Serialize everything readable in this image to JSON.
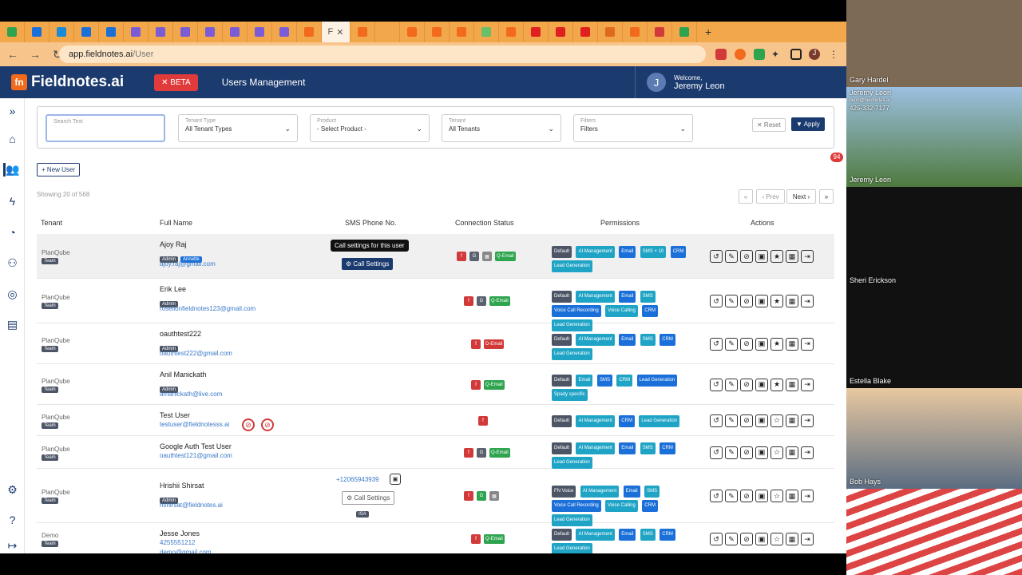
{
  "browser": {
    "active_tab_label": "F",
    "url_host": "app.fieldnotes.ai",
    "url_path": "/User",
    "tab_count": 28
  },
  "app": {
    "logo_text": "Fieldnotes.ai",
    "logo_mark": "fn",
    "beta_label": "✕ BETA",
    "page_title": "Users Management",
    "welcome_label": "Welcome,",
    "user_name": "Jeremy Leon",
    "avatar_letter": "J"
  },
  "filters": {
    "search_placeholder": "Search Text",
    "tenant_type": {
      "label": "Tenant Type",
      "value": "All Tenant Types"
    },
    "product": {
      "label": "Product",
      "value": "- Select Product -"
    },
    "tenant": {
      "label": "Tenant",
      "value": "All Tenants"
    },
    "filters": {
      "label": "Filters",
      "value": "Filters"
    },
    "reset": "✕ Reset",
    "apply": "Apply"
  },
  "toolbar": {
    "new_user": "+ New User",
    "showing": "Showing 20 of 568",
    "prev": "‹ Prev",
    "next": "Next ›",
    "notif_badge": "94"
  },
  "table": {
    "headers": [
      "Tenant",
      "Full Name",
      "SMS Phone No.",
      "Connection Status",
      "Permissions",
      "Actions"
    ],
    "rows": [
      {
        "tenant": "PlanQube",
        "role": "Team",
        "name": "Ajoy Raj",
        "badges": [
          "Admin",
          "Annette"
        ],
        "email": "ajoy.raj@gmail.com",
        "call": "Call Settings",
        "conn": [
          "f",
          "G",
          "▦",
          "Q-Email"
        ],
        "perms": [
          "Default",
          "AI Management",
          "Email",
          "SMS + 10",
          "CRM",
          "Lead Generation"
        ]
      },
      {
        "tenant": "PlanQube",
        "role": "Team",
        "name": "Erik Lee",
        "badges": [
          "Admin"
        ],
        "email": "roselionfieldnotes123@gmail.com",
        "conn": [
          "f",
          "G",
          "Q-Email"
        ],
        "perms": [
          "Default",
          "AI Management",
          "Email",
          "SMS",
          "Voice Call Recording",
          "Voice Calling",
          "CRM",
          "Lead Generation"
        ]
      },
      {
        "tenant": "PlanQube",
        "role": "Team",
        "name": "oauthtest222",
        "badges": [
          "Admin"
        ],
        "email": "oauthtest222@gmail.com",
        "conn": [
          "f",
          "D-Email"
        ],
        "perms": [
          "Default",
          "AI Management",
          "Email",
          "SMS",
          "CRM",
          "Lead Generation"
        ]
      },
      {
        "tenant": "PlanQube",
        "role": "Team",
        "name": "Anil Manickath",
        "badges": [
          "Admin"
        ],
        "email": "amanickath@live.com",
        "conn": [
          "f",
          "Q-Email"
        ],
        "perms": [
          "Default",
          "Email",
          "SMS",
          "CRM",
          "Lead Generation",
          "Spady specific"
        ]
      },
      {
        "tenant": "PlanQube",
        "role": "Team",
        "name": "Test User",
        "badges": [],
        "email": "testuser@fieldnotesss.ai",
        "conn": [
          "f"
        ],
        "perms": [
          "Default",
          "AI Management",
          "CRM",
          "Lead Generation"
        ]
      },
      {
        "tenant": "PlanQube",
        "role": "Team",
        "name": "Google Auth Test User",
        "badges": [],
        "email": "oauthtest121@gmail.com",
        "conn": [
          "f",
          "G",
          "Q-Email"
        ],
        "perms": [
          "Default",
          "AI Management",
          "Email",
          "SMS",
          "CRM",
          "Lead Generation"
        ]
      },
      {
        "tenant": "PlanQube",
        "role": "Team",
        "name": "Hrishii Shirsat",
        "badges": [
          "Admin"
        ],
        "email": "hshirsat@fieldnotes.ai",
        "phone": "+12065943939",
        "call": "Call Settings",
        "isa": "ISA",
        "conn": [
          "f",
          "G",
          "▦"
        ],
        "perms": [
          "FN Voice",
          "AI Management",
          "Email",
          "SMS",
          "Voice Call Recording",
          "Voice Calling",
          "CRM",
          "Lead Generation"
        ]
      },
      {
        "tenant": "Demo",
        "role": "Team",
        "name": "Jesse Jones",
        "badges": [],
        "email": "demo@gmail.com",
        "phone_text": "4255551212",
        "conn": [
          "f",
          "Q-Email"
        ],
        "perms": [
          "Default",
          "AI Management",
          "Email",
          "SMS",
          "CRM",
          "Lead Generation"
        ]
      }
    ]
  },
  "tooltip": "Call settings for this user",
  "video": {
    "participants": [
      "Gary Hardel",
      "Jeremy Leon",
      "Sheri Erickson",
      "Estella Blake",
      "Bob Hays"
    ],
    "overlay_name": "Jeremy Leon",
    "overlay_email": "jleon@fieldnotes.ai",
    "overlay_phone": "425-332-7177"
  }
}
